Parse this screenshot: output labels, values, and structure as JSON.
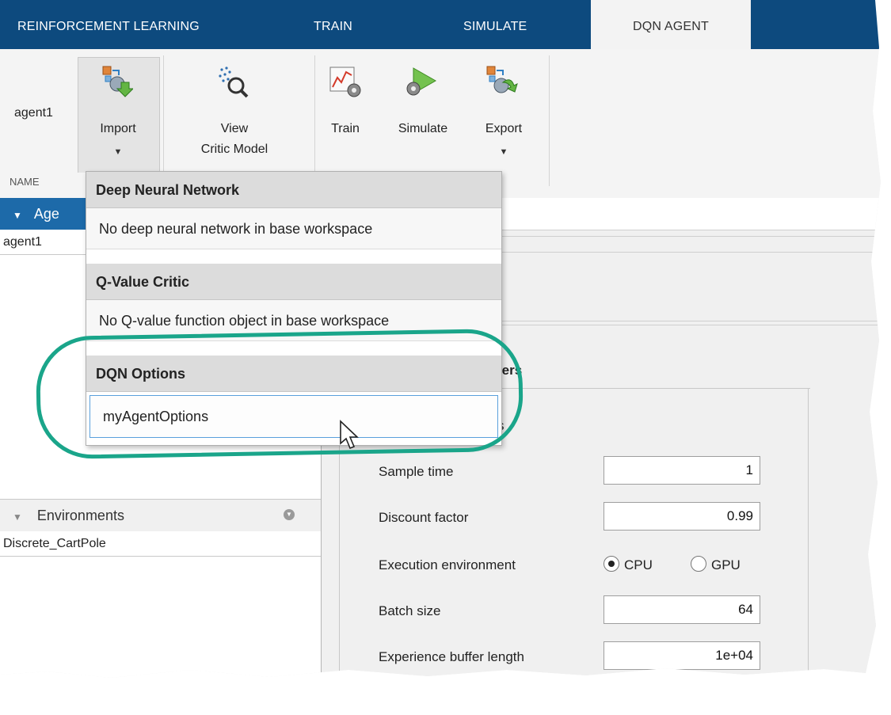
{
  "tabs": {
    "t1": "REINFORCEMENT LEARNING",
    "t2": "TRAIN",
    "t3": "SIMULATE",
    "t4": "DQN AGENT"
  },
  "ribbon": {
    "agent_name": "agent1",
    "import_label": "Import",
    "view_label_1": "View",
    "view_label_2": "Critic Model",
    "train_label": "Train",
    "simulate_label": "Simulate",
    "export_label": "Export",
    "section_name": "NAME"
  },
  "left_panel": {
    "agents_header": "Age",
    "agent_item": "agent1",
    "environments_header": "Environments",
    "environment_item": "Discrete_CartPole"
  },
  "menu": {
    "h1": "Deep Neural Network",
    "i1": "No deep neural network in base workspace",
    "h2": "Q-Value Critic",
    "i2": "No Q-value function object in base workspace",
    "h3": "DQN Options",
    "i3": "myAgentOptions"
  },
  "params": {
    "section_partial": "ters",
    "sub_partial": "s",
    "sample_time_label": "Sample time",
    "sample_time": "1",
    "discount_label": "Discount factor",
    "discount": "0.99",
    "exec_label": "Execution environment",
    "cpu": "CPU",
    "gpu": "GPU",
    "batch_label": "Batch size",
    "batch": "64",
    "buffer_label": "Experience buffer length",
    "buffer": "1e+04"
  }
}
